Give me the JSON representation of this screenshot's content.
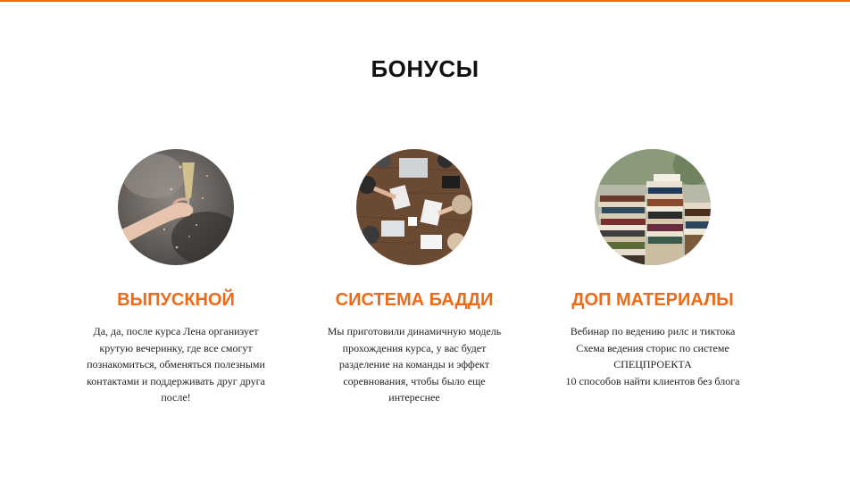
{
  "colors": {
    "accent": "#ef6a16",
    "heading": "#111111",
    "body_text": "#222222",
    "background": "#ffffff"
  },
  "section": {
    "title": "БОНУСЫ"
  },
  "cards": [
    {
      "image_icon": "champagne-toast-photo",
      "title": "ВЫПУСКНОЙ",
      "text": "Да, да, после курса Лена организует крутую вечеринку, где все смогут познакомиться, обменяться полезными контактами и поддерживать друг друга после!"
    },
    {
      "image_icon": "team-meeting-table-photo",
      "title": "СИСТЕМА БАДДИ",
      "text": "Мы приготовили динамичную модель прохождения курса, у вас будет разделение на команды и эффект соревнования, чтобы было еще интереснее"
    },
    {
      "image_icon": "book-stacks-photo",
      "title": "ДОП МАТЕРИАЛЫ",
      "lines": [
        "Вебинар по ведению рилс и тиктока",
        "Схема ведения сторис по системе СПЕЦПРОЕКТА",
        "10 способов найти клиентов без блога"
      ]
    }
  ]
}
